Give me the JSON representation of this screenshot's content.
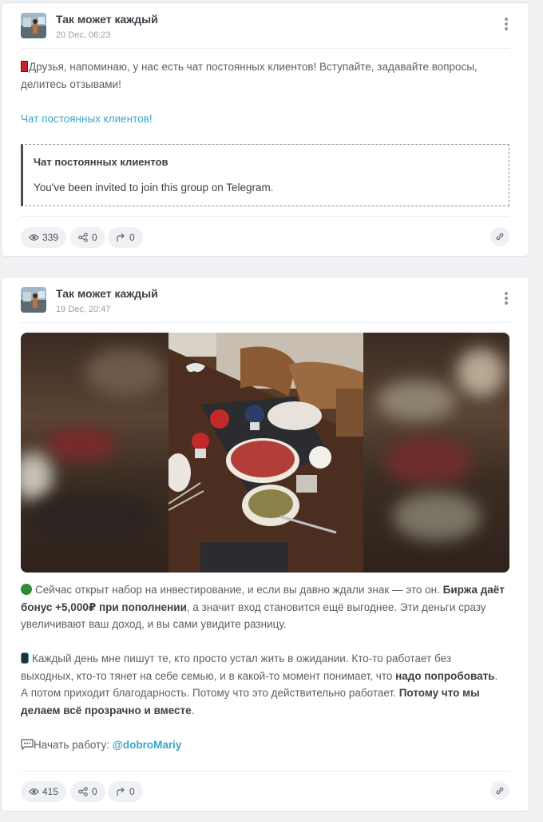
{
  "posts": [
    {
      "channel": "Так может каждый",
      "date": "20 Dec, 06:23",
      "body": "Друзья, напоминаю, у нас есть чат постоянных клиентов! Вступайте, задавайте вопросы, делитесь отзывами!",
      "link_text": "Чат постоянных клиентов!",
      "preview_title": "Чат постоянных клиентов",
      "preview_desc": "You've been invited to join this group on Telegram.",
      "views": "339",
      "shares": "0",
      "forwards": "0"
    },
    {
      "channel": "Так может каждый",
      "date": "19 Dec, 20:47",
      "p1_a": "Сейчас открыт набор на инвестирование, и если вы давно ждали знак — это он.",
      "p1_b": "Биржа даёт бонус +5,000₽ при пополнении",
      "p1_c": ", а значит вход становится ещё выгоднее. Эти деньги сразу увеличивают ваш доход, и вы сами увидите разницу.",
      "p2_a": "Каждый день мне пишут те, кто просто устал жить в ожидании. Кто-то работает без выходных, кто-то тянет на себе семью, и в какой-то момент понимает, что",
      "p2_b": "надо попробовать",
      "p2_c": ". А потом приходит благодарность. Потому что это действительно работает.",
      "p2_d": "Потому что мы делаем всё прозрачно и вместе",
      "p2_e": ".",
      "cta_label": "Начать работу:",
      "cta_handle": "@dobroMariy",
      "views": "415",
      "shares": "0",
      "forwards": "0"
    }
  ],
  "icons": [
    "avatar",
    "more-vertical-icon",
    "eye-icon",
    "share-icon",
    "forward-icon",
    "link-icon",
    "red-marker-icon",
    "money-icon",
    "phone-icon",
    "speech-bubble-icon"
  ]
}
